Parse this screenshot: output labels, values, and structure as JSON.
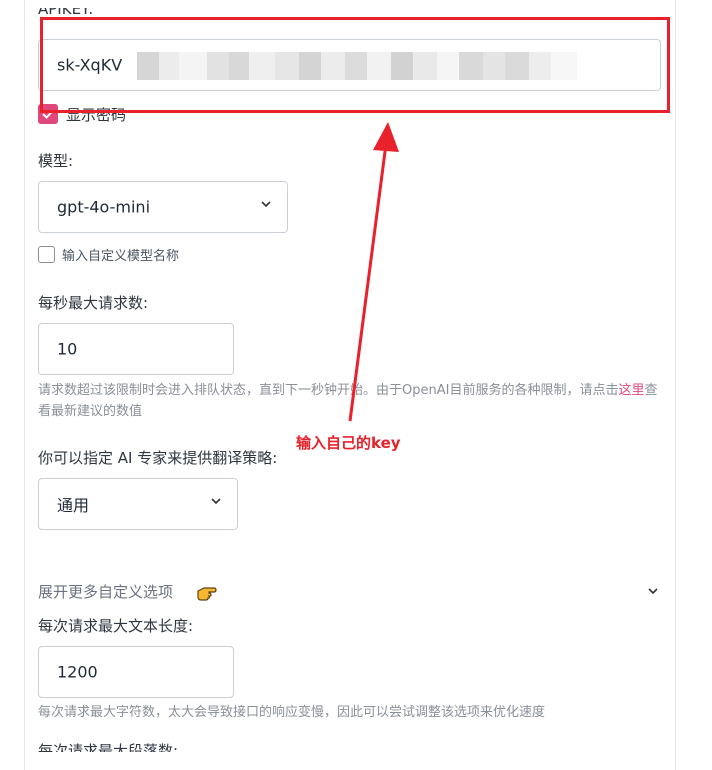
{
  "apikey": {
    "label": "APIKEY:",
    "value_visible": "sk-XqKV",
    "show_password_label": "显示密码"
  },
  "model": {
    "label": "模型:",
    "selected": "gpt-4o-mini",
    "custom_name_label": "输入自定义模型名称"
  },
  "rate": {
    "label": "每秒最大请求数:",
    "value": "10",
    "help_before": "请求数超过该限制时会进入排队状态，直到下一秒钟开始。由于OpenAI目前服务的各种限制，请点击",
    "help_link": "这里",
    "help_after": "查看最新建议的数值"
  },
  "expert": {
    "label": "你可以指定 AI 专家来提供翻译策略:",
    "selected": "通用"
  },
  "more_options": {
    "label": "展开更多自定义选项"
  },
  "max_text": {
    "label": "每次请求最大文本长度:",
    "value": "1200",
    "help": "每次请求最大字符数，太大会导致接口的响应变慢，因此可以尝试调整该选项来优化速度"
  },
  "max_paragraphs": {
    "label": "每次请求最大段落数:"
  },
  "annotation": {
    "text": "输入自己的key",
    "color": "#e8212b"
  },
  "colors": {
    "accent": "#e0477a",
    "annotation": "#e8212b",
    "help_text": "#8a8f98"
  }
}
